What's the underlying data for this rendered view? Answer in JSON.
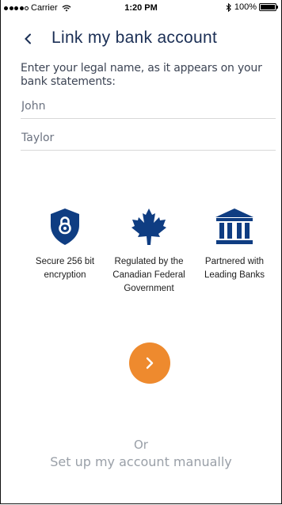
{
  "status_bar": {
    "carrier": "Carrier",
    "time": "1:20 PM",
    "battery": "100%",
    "icons": [
      "signal-icon",
      "wifi-icon",
      "bluetooth-icon",
      "battery-icon"
    ]
  },
  "header": {
    "title": "Link my bank account",
    "back_icon": "chevron-left-icon"
  },
  "form": {
    "instructions": "Enter your legal name, as it appears on your bank statements:",
    "first_name": "John",
    "last_name": "Taylor"
  },
  "features": [
    {
      "icon": "shield-lock-icon",
      "label": "Secure 256 bit encryption"
    },
    {
      "icon": "maple-leaf-icon",
      "label": "Regulated by the Canadian Federal Government"
    },
    {
      "icon": "bank-icon",
      "label": "Partnered with Leading Banks"
    }
  ],
  "actions": {
    "next_icon": "chevron-right-icon",
    "or_text": "Or",
    "manual_link": "Set up my account manually"
  },
  "colors": {
    "title": "#1b2f55",
    "icon": "#0f3d82",
    "accent": "#ee8a2e",
    "muted": "#9aa0a8"
  }
}
